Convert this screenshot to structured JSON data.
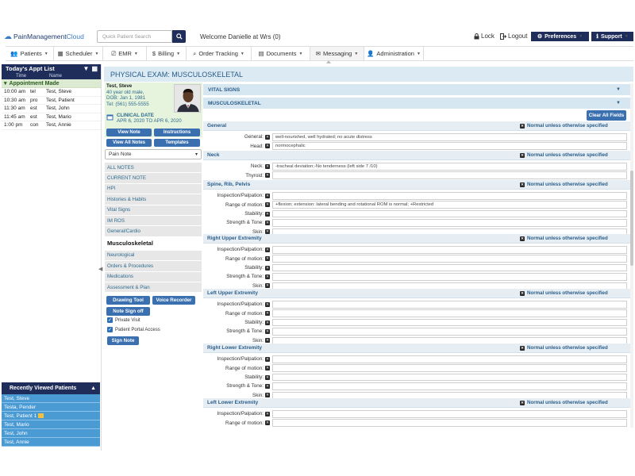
{
  "header": {
    "logo": {
      "part1": "PainManagement",
      "part2": "Cloud"
    },
    "search_placeholder": "Quick Patient Search",
    "welcome": "Welcome Danielle at Wrs (0)",
    "lock": "Lock",
    "logout": "Logout",
    "preferences": "Preferences",
    "support": "Support"
  },
  "nav": {
    "items": [
      {
        "label": "Patients",
        "icon": "users-icon"
      },
      {
        "label": "Scheduler",
        "icon": "calendar-icon"
      },
      {
        "label": "EMR",
        "icon": "emr-icon"
      },
      {
        "label": "Billing",
        "icon": "dollar-icon"
      },
      {
        "label": "Order Tracking",
        "icon": "search-icon"
      },
      {
        "label": "Documents",
        "icon": "document-icon"
      },
      {
        "label": "Messaging",
        "icon": "envelope-icon"
      },
      {
        "label": "Administration",
        "icon": "admin-icon"
      }
    ]
  },
  "appts": {
    "title": "Today's Appt List",
    "col_time": "Time",
    "col_name": "Name",
    "group": "Appointment Made",
    "rows": [
      {
        "time": "10:00 am",
        "type": "tel",
        "name": "Test, Steve"
      },
      {
        "time": "10:30 am",
        "type": "pro",
        "name": "Test, Patient"
      },
      {
        "time": "11:30 am",
        "type": "est",
        "name": "Test, John"
      },
      {
        "time": "11:45 am",
        "type": "est",
        "name": "Test, Mario"
      },
      {
        "time": "1:00 pm",
        "type": "con",
        "name": "Test, Annie"
      }
    ]
  },
  "recent": {
    "title": "Recently Viewed Patients",
    "items": [
      "Test, Steve",
      "Testa, Pender",
      "Test, Patient 1",
      "Test, Mario",
      "Test, John",
      "Test, Annie"
    ]
  },
  "note": {
    "title": "PHYSICAL EXAM: MUSCULOSKELETAL"
  },
  "patient": {
    "name": "Test, Steve",
    "age_line": "40 year old male,",
    "dob": "DOB: Jan 1, 1981",
    "tel": "Tel: (561) 555-5555",
    "clinical_label": "CLINICAL DATE",
    "clinical_date": "APR 6, 2020 TO APR 6, 2020"
  },
  "buttons": {
    "view_note": "View Note",
    "instructions": "Instructions",
    "view_all": "View All Notes",
    "templates": "Templates",
    "drawing": "Drawing Tool",
    "voice": "Voice Recorder",
    "sign_off": "Note Sign off",
    "sign_note": "Sign Note",
    "clear_all": "Clear All Fields"
  },
  "note_select": "Pain Note",
  "sections": [
    "ALL NOTES",
    "CURRENT NOTE",
    "HPI",
    "Histories & Habits",
    "Vital Signs",
    "IM ROS",
    "General/Cardio",
    "Musculoskeletal",
    "Neurological",
    "Orders & Procedures",
    "Medications",
    "Assessment & Plan"
  ],
  "active_section_index": 7,
  "checks": {
    "private": "Private Visit",
    "portal": "Patient Portal Access"
  },
  "exam": {
    "vital_signs": "VITAL SIGNS",
    "musculoskeletal": "MUSCULOSKELETAL",
    "normal_text": "Normal unless otherwise specified",
    "groups": [
      {
        "title": "General",
        "fields": [
          {
            "label": "General:",
            "value": "well-nourished, well hydrated; no acute distress"
          },
          {
            "label": "Head:",
            "value": "normocephalic"
          }
        ]
      },
      {
        "title": "Neck",
        "fields": [
          {
            "label": "Neck:",
            "value": "-tracheal deviation;-No tenderness (left side 7 /10)"
          },
          {
            "label": "Thyroid:",
            "value": ""
          }
        ]
      },
      {
        "title": "Spine, Rib, Pelvis",
        "fields": [
          {
            "label": "Inspection/Palpation:",
            "value": ""
          },
          {
            "label": "Range of motion:",
            "value": "+flexion; extension: lateral bending and rotational ROM is normal; +Restricted"
          },
          {
            "label": "Stability:",
            "value": ""
          },
          {
            "label": "Strength & Tone:",
            "value": ""
          },
          {
            "label": "Skin:",
            "value": ""
          }
        ]
      },
      {
        "title": "Right Upper Extremity",
        "fields": [
          {
            "label": "Inspection/Palpation:",
            "value": ""
          },
          {
            "label": "Range of motion:",
            "value": ""
          },
          {
            "label": "Stability:",
            "value": ""
          },
          {
            "label": "Strength & Tone:",
            "value": ""
          },
          {
            "label": "Skin:",
            "value": ""
          }
        ]
      },
      {
        "title": "Left Upper Extremity",
        "fields": [
          {
            "label": "Inspection/Palpation:",
            "value": ""
          },
          {
            "label": "Range of motion:",
            "value": ""
          },
          {
            "label": "Stability:",
            "value": ""
          },
          {
            "label": "Strength & Tone:",
            "value": ""
          },
          {
            "label": "Skin:",
            "value": ""
          }
        ]
      },
      {
        "title": "Right Lower Extremity",
        "fields": [
          {
            "label": "Inspection/Palpation:",
            "value": ""
          },
          {
            "label": "Range of motion:",
            "value": ""
          },
          {
            "label": "Stability:",
            "value": ""
          },
          {
            "label": "Strength & Tone:",
            "value": ""
          },
          {
            "label": "Skin:",
            "value": ""
          }
        ]
      },
      {
        "title": "Left Lower Extremity",
        "fields": [
          {
            "label": "Inspection/Palpation:",
            "value": ""
          },
          {
            "label": "Range of motion:",
            "value": ""
          }
        ]
      }
    ]
  },
  "colors": {
    "navy": "#1f2d5a",
    "button_blue": "#3a6fb0",
    "recent_blue": "#4a9ad4",
    "patient_green": "#e6f4dd",
    "section_blue": "#d7e7f1"
  }
}
